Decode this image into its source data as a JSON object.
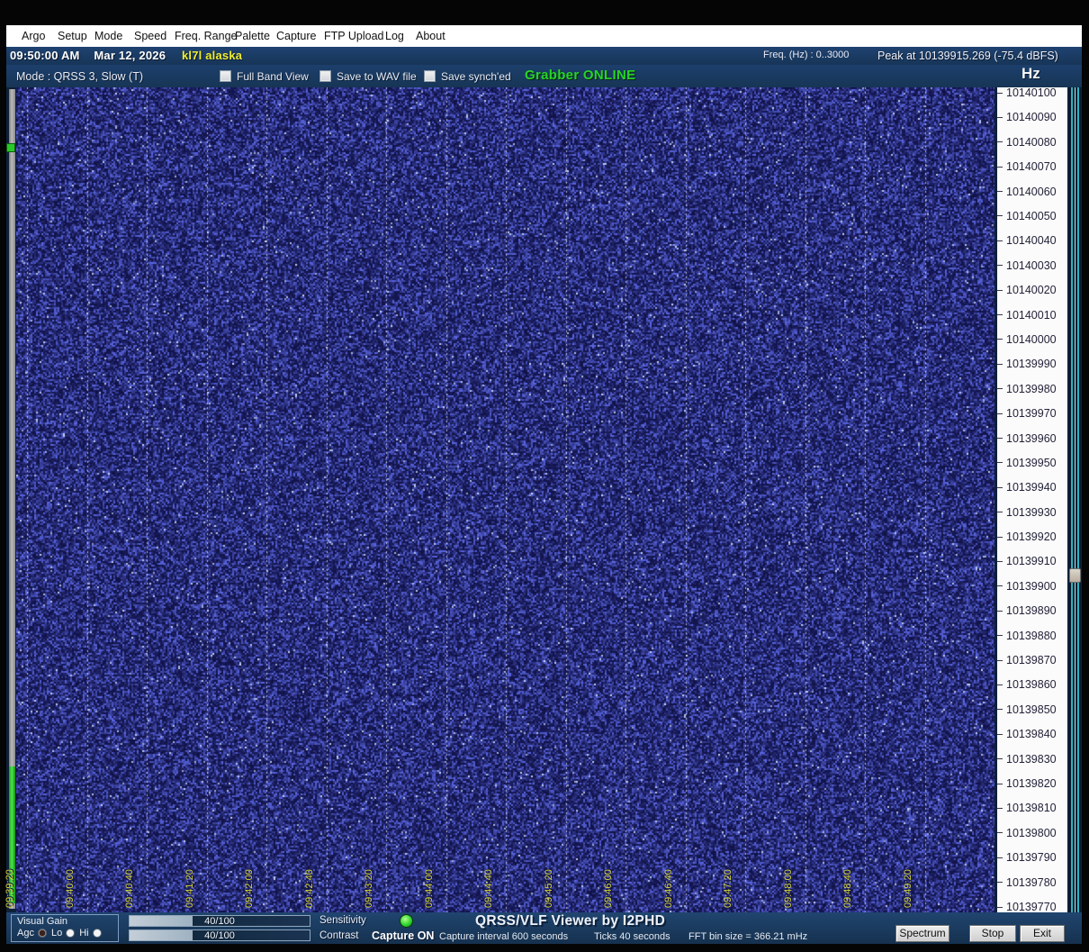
{
  "menu": {
    "items": [
      "Argo",
      "Setup",
      "Mode",
      "Speed",
      "Freq. Range",
      "Palette",
      "Capture",
      "FTP Upload",
      "Log",
      "About"
    ]
  },
  "header": {
    "time": "09:50:00 AM",
    "date": "Mar 12, 2026",
    "callsign": "kl7l alaska",
    "freq_range_label": "Freq. (Hz) :  0..3000",
    "peak_label": "Peak at 10139915.269 (-75.4 dBFS)",
    "mode_label": "Mode : QRSS 3, Slow (T)",
    "checkboxes": [
      {
        "label": "Full Band View",
        "checked": false
      },
      {
        "label": "Save to WAV file",
        "checked": false
      },
      {
        "label": "Save synch'ed",
        "checked": false
      }
    ],
    "grabber_status": "Grabber ONLINE",
    "hz_label": "Hz"
  },
  "spectrogram": {
    "type": "waterfall-noise",
    "time_ticks": [
      "09:39:20",
      "09:40:00",
      "09:40:40",
      "09:41:20",
      "09:42:00",
      "09:42:40",
      "09:43:20",
      "09:44:00",
      "09:44:40",
      "09:45:20",
      "09:46:00",
      "09:46:40",
      "09:47:20",
      "09:48:00",
      "09:48:40",
      "09:49:20"
    ],
    "freq_ticks": [
      "10140100",
      "10140090",
      "10140080",
      "10140070",
      "10140060",
      "10140050",
      "10140040",
      "10140030",
      "10140020",
      "10140010",
      "10140000",
      "10139990",
      "10139980",
      "10139970",
      "10139960",
      "10139950",
      "10139940",
      "10139930",
      "10139920",
      "10139910",
      "10139900",
      "10139890",
      "10139880",
      "10139870",
      "10139860",
      "10139850",
      "10139840",
      "10139830",
      "10139820",
      "10139810",
      "10139800",
      "10139790",
      "10139780",
      "10139770"
    ],
    "colors": {
      "noise_base": "#161a54",
      "noise_bright": "#7a86cc",
      "tick_line": "#e8ecff",
      "time_label": "#d4d438",
      "axis_bg": "#fbfbfb",
      "axis_text": "#23233a"
    }
  },
  "bottom": {
    "visual_gain": {
      "label": "Visual Gain",
      "options": [
        {
          "label": "Agc",
          "selected": true
        },
        {
          "label": "Lo",
          "selected": false
        },
        {
          "label": "Hi",
          "selected": false
        }
      ]
    },
    "sensitivity": {
      "label": "Sensitivity",
      "value": "40/100"
    },
    "contrast": {
      "label": "Contrast",
      "value": "40/100"
    },
    "capture_status": "Capture ON",
    "app_title": "QRSS/VLF Viewer by I2PHD",
    "capture_interval": "Capture interval 600 seconds",
    "ticks_info": "Ticks  40 seconds",
    "fft_info": "FFT bin size = 366.21 mHz",
    "buttons": [
      "Spectrum",
      "Stop",
      "Exit"
    ]
  },
  "colors": {
    "header_blue": "#1a3a64",
    "accent_yellow": "#f0ee2c",
    "accent_green": "#27d427",
    "menu_bg": "#ffffff"
  }
}
